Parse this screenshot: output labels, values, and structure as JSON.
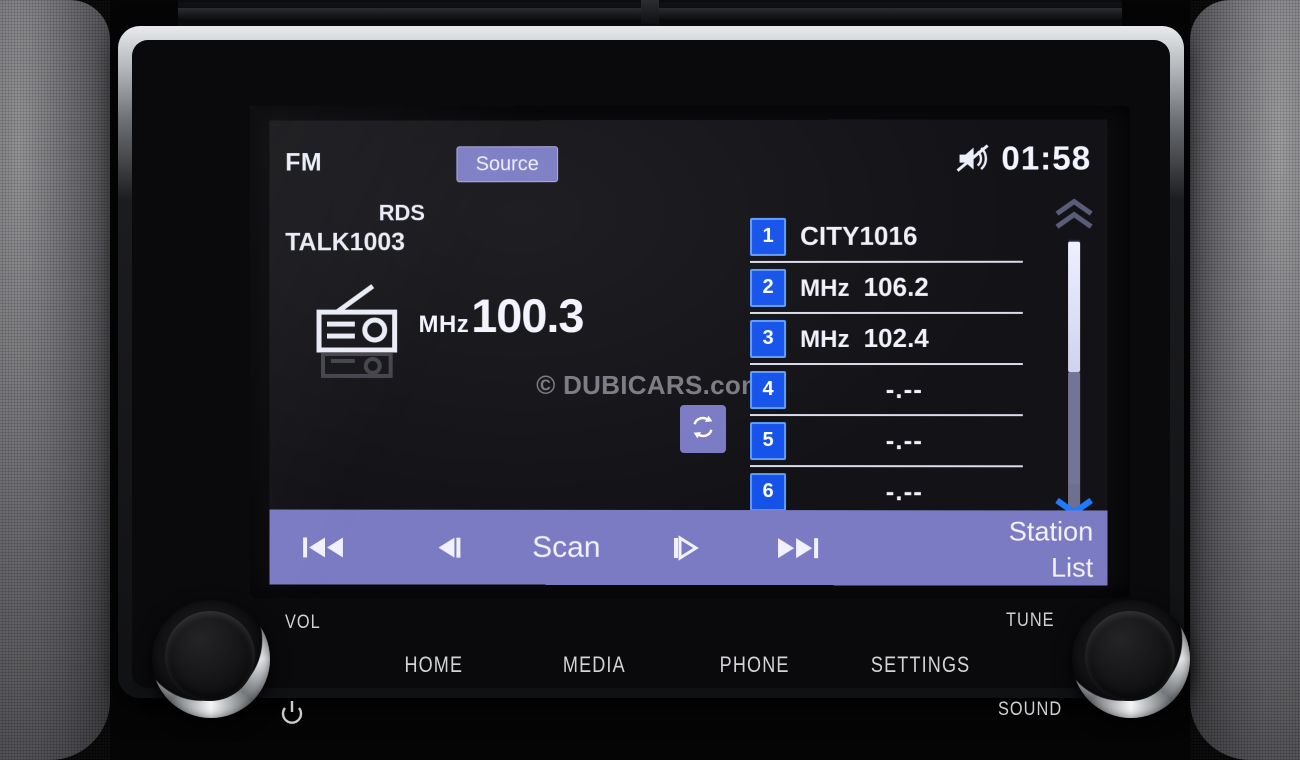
{
  "head_unit": {
    "screen": {
      "band_label": "FM",
      "source_button": "Source",
      "rds_label": "RDS",
      "station_name": "TALK1003",
      "frequency_unit": "MHz",
      "frequency_value": "100.3",
      "clock": "01:58",
      "mute_icon": "speaker-mute-icon",
      "radio_icon": "radio-receiver-icon",
      "refresh_icon": "refresh-circular-arrows-icon",
      "watermark": "© DUBICARS.com",
      "presets": [
        {
          "number": "1",
          "unit": "",
          "value": "CITY1016",
          "empty": false
        },
        {
          "number": "2",
          "unit": "MHz",
          "value": "106.2",
          "empty": false
        },
        {
          "number": "3",
          "unit": "MHz",
          "value": "102.4",
          "empty": false
        },
        {
          "number": "4",
          "unit": "",
          "value": "-.--",
          "empty": true
        },
        {
          "number": "5",
          "unit": "",
          "value": "-.--",
          "empty": true
        },
        {
          "number": "6",
          "unit": "",
          "value": "-.--",
          "empty": true
        }
      ],
      "scrollbar": {
        "up_icon": "chevron-double-up-icon",
        "down_icon": "chevron-double-down-icon"
      },
      "bottom_bar": {
        "prev_icon": "skip-previous-icon",
        "step_back_icon": "seek-back-icon",
        "scan_label": "Scan",
        "step_forward_icon": "seek-forward-icon",
        "next_icon": "skip-next-icon",
        "station_list_line1": "Station",
        "station_list_line2": "List"
      },
      "colors": {
        "accent_purple": "#7b7bc4",
        "preset_blue": "#1552ea",
        "preset_blue_border": "#5f9bff",
        "scroll_down_blue": "#1e7bff",
        "screen_bg": "#131317",
        "text_white": "#f0f1fa"
      }
    },
    "hardware": {
      "vol_label": "VOL",
      "power_icon": "power-icon",
      "tune_label": "TUNE",
      "sound_label": "SOUND",
      "buttons": [
        {
          "label": "HOME"
        },
        {
          "label": "MEDIA"
        },
        {
          "label": "PHONE"
        },
        {
          "label": "SETTINGS"
        }
      ],
      "left_knob": "volume-knob",
      "right_knob": "tune-knob"
    }
  }
}
